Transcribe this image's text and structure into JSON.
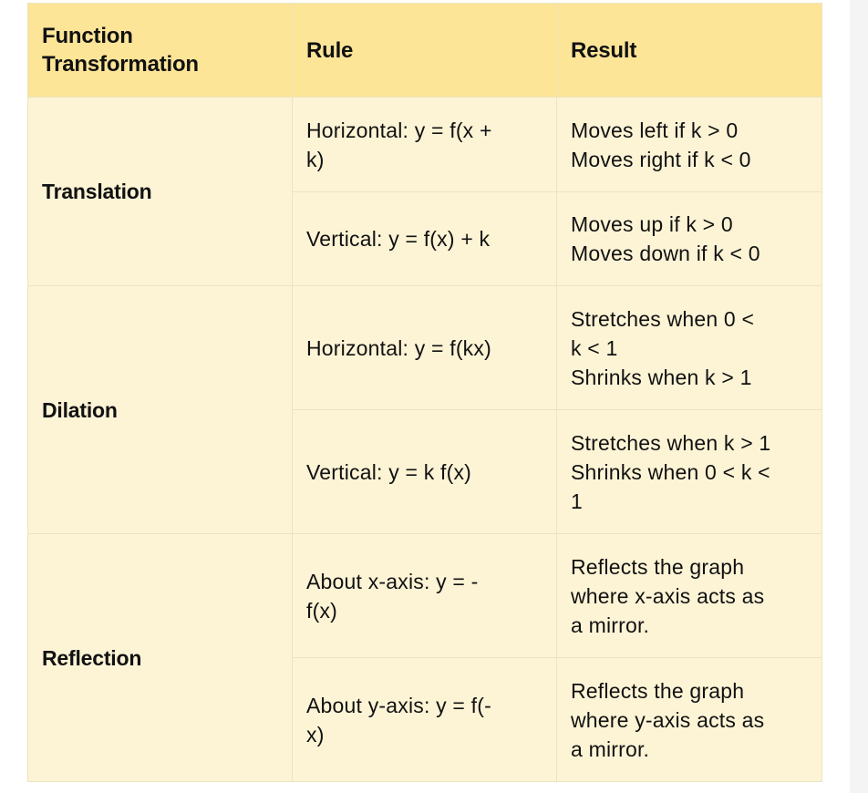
{
  "table": {
    "headers": {
      "col1_line1": "Function",
      "col1_line2": "Transformation",
      "col2": "Rule",
      "col3": "Result"
    },
    "groups": [
      {
        "name": "Translation",
        "rows": [
          {
            "rule": [
              "Horizontal: y = f(x +",
              "k)"
            ],
            "result": [
              "Moves left if k > 0",
              "Moves right if k < 0"
            ]
          },
          {
            "rule": [
              "Vertical: y = f(x) + k"
            ],
            "result": [
              "Moves up if k > 0",
              "Moves down if k < 0"
            ]
          }
        ]
      },
      {
        "name": "Dilation",
        "rows": [
          {
            "rule": [
              "Horizontal: y = f(kx)"
            ],
            "result": [
              "Stretches when 0 <",
              "k < 1",
              "Shrinks when k > 1"
            ]
          },
          {
            "rule": [
              "Vertical: y = k f(x)"
            ],
            "result": [
              "Stretches when k > 1",
              "Shrinks when 0 < k <",
              "1"
            ]
          }
        ]
      },
      {
        "name": "Reflection",
        "rows": [
          {
            "rule": [
              "About x-axis: y = -",
              "f(x)"
            ],
            "result": [
              "Reflects the graph",
              "where x-axis acts as",
              "a mirror."
            ]
          },
          {
            "rule": [
              "About y-axis: y = f(-",
              "x)"
            ],
            "result": [
              "Reflects the graph",
              "where y-axis acts as",
              "a mirror."
            ]
          }
        ]
      }
    ]
  }
}
